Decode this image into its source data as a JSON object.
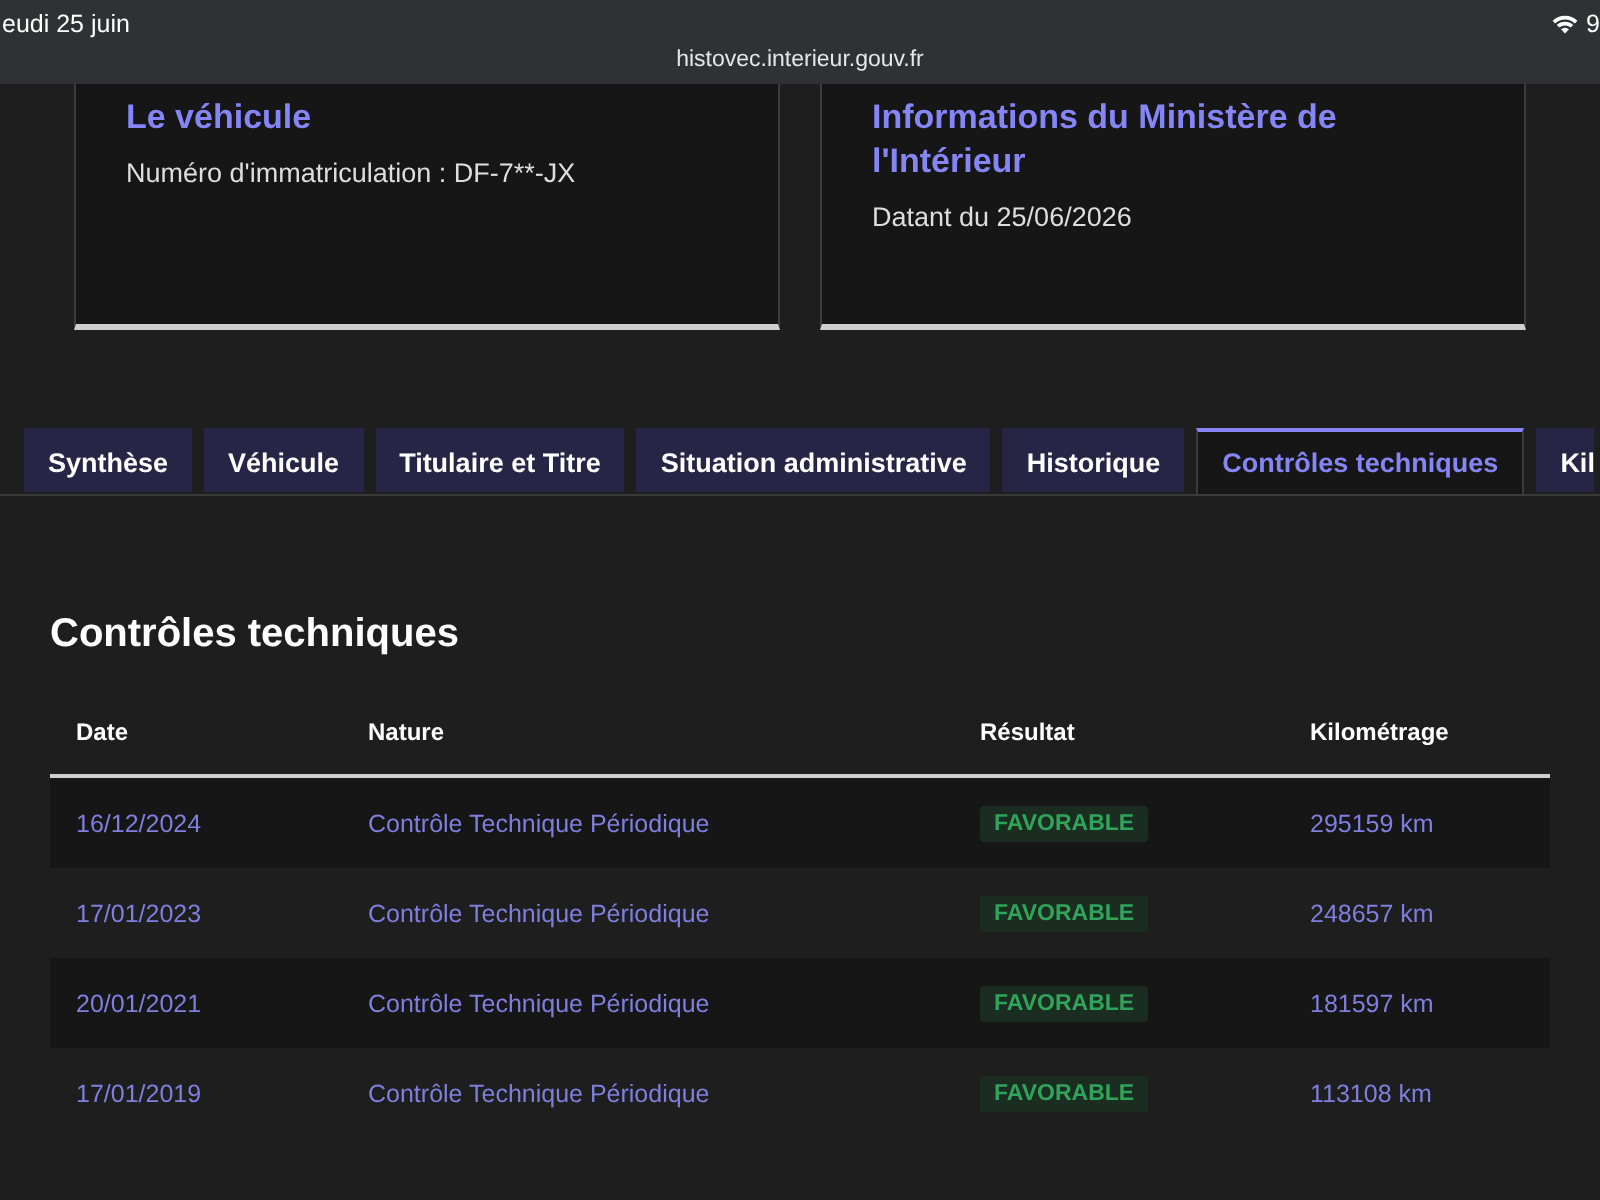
{
  "status_bar": {
    "date": "eudi 25 juin",
    "battery": "9"
  },
  "browser": {
    "url": "histovec.interieur.gouv.fr"
  },
  "cards": [
    {
      "title": "Le véhicule",
      "lines": [
        "Numéro d'immatriculation : DF-7**-JX"
      ]
    },
    {
      "title": "Informations du Ministère de l'Intérieur",
      "lines": [
        "Datant du 25/06/2026"
      ]
    }
  ],
  "tabs": [
    {
      "label": "Synthèse",
      "selected": false
    },
    {
      "label": "Véhicule",
      "selected": false
    },
    {
      "label": "Titulaire et Titre",
      "selected": false
    },
    {
      "label": "Situation administrative",
      "selected": false
    },
    {
      "label": "Historique",
      "selected": false
    },
    {
      "label": "Contrôles techniques",
      "selected": true
    },
    {
      "label": "Kil",
      "selected": false
    }
  ],
  "section": {
    "title": "Contrôles techniques",
    "table": {
      "columns": [
        "Date",
        "Nature",
        "Résultat",
        "Kilométrage"
      ],
      "rows": [
        {
          "date": "16/12/2024",
          "nature": "Contrôle Technique Périodique",
          "result": "FAVORABLE",
          "mileage": "295159 km"
        },
        {
          "date": "17/01/2023",
          "nature": "Contrôle Technique Périodique",
          "result": "FAVORABLE",
          "mileage": "248657 km"
        },
        {
          "date": "20/01/2021",
          "nature": "Contrôle Technique Périodique",
          "result": "FAVORABLE",
          "mileage": "181597 km"
        },
        {
          "date": "17/01/2019",
          "nature": "Contrôle Technique Périodique",
          "result": "FAVORABLE",
          "mileage": "113108 km"
        }
      ]
    }
  }
}
